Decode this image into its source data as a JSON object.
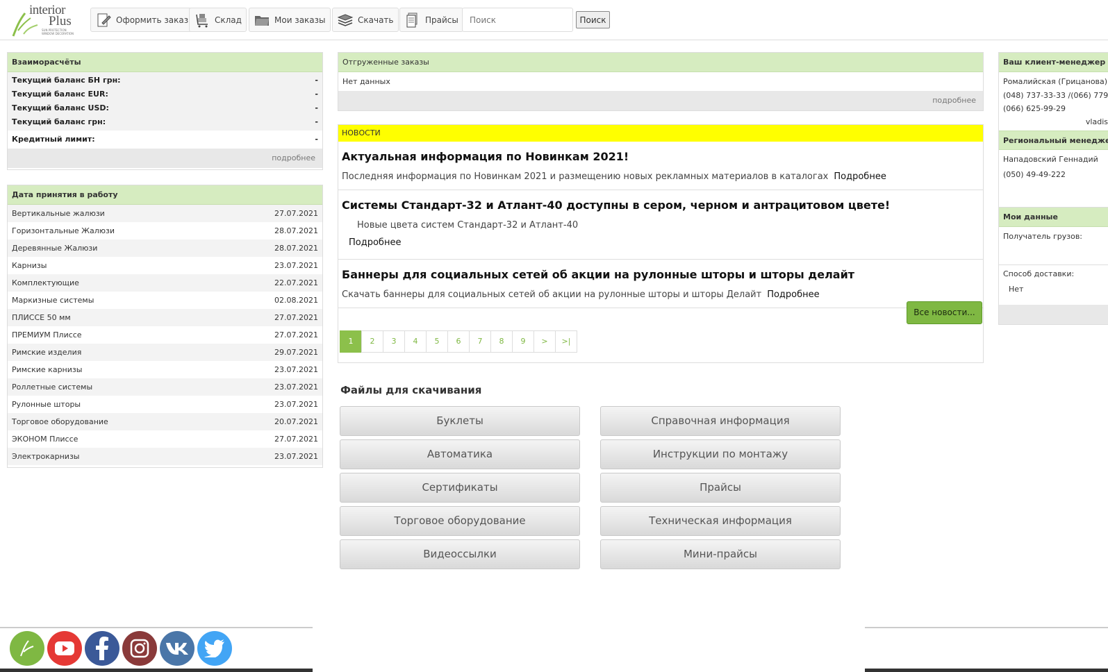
{
  "header": {
    "logo_word1": "interior",
    "logo_word2": "Plus",
    "logo_tagline": "SUN PROTECTION WINDOW DECORATION",
    "nav": [
      {
        "label": "Оформить заказ",
        "icon": "edit-order-icon"
      },
      {
        "label": "Склад",
        "icon": "warehouse-cart-icon"
      },
      {
        "label": "Мои заказы",
        "icon": "folder-icon"
      },
      {
        "label": "Скачать",
        "icon": "stack-download-icon"
      },
      {
        "label": "Прайсы",
        "icon": "price-document-icon"
      }
    ],
    "search_placeholder": "Поиск",
    "search_button": "Поиск"
  },
  "balance": {
    "title": "Взаиморасчёты",
    "rows": [
      {
        "label": "Текущий баланс БН грн:",
        "value": "-"
      },
      {
        "label": "Текущий баланс EUR:",
        "value": "-"
      },
      {
        "label": "Текущий баланс USD:",
        "value": "-"
      },
      {
        "label": "Текущий баланс грн:",
        "value": "-"
      }
    ],
    "credit_label": "Кредитный лимит:",
    "credit_value": "-",
    "more": "подробнее"
  },
  "accept_dates": {
    "title": "Дата принятия в работу",
    "rows": [
      {
        "name": "Вертикальные жалюзи",
        "date": "27.07.2021"
      },
      {
        "name": "Горизонтальные Жалюзи",
        "date": "28.07.2021"
      },
      {
        "name": "Деревянные Жалюзи",
        "date": "28.07.2021"
      },
      {
        "name": "Карнизы",
        "date": "23.07.2021"
      },
      {
        "name": "Комплектующие",
        "date": "22.07.2021"
      },
      {
        "name": "Маркизные системы",
        "date": "02.08.2021"
      },
      {
        "name": "ПЛИССЕ 50 мм",
        "date": "27.07.2021"
      },
      {
        "name": "ПРЕМИУМ Плиссе",
        "date": "27.07.2021"
      },
      {
        "name": "Римские изделия",
        "date": "29.07.2021"
      },
      {
        "name": "Римские карнизы",
        "date": "23.07.2021"
      },
      {
        "name": "Роллетные системы",
        "date": "23.07.2021"
      },
      {
        "name": "Рулонные шторы",
        "date": "23.07.2021"
      },
      {
        "name": "Торговое оборудование",
        "date": "20.07.2021"
      },
      {
        "name": "ЭКОНОМ Плиссе",
        "date": "27.07.2021"
      },
      {
        "name": "Электрокарнизы",
        "date": "23.07.2021"
      }
    ]
  },
  "shipped": {
    "title": "Отгруженные заказы",
    "empty": "Нет данных",
    "more": "подробнее"
  },
  "news": {
    "title": "НОВОСТИ",
    "items": [
      {
        "title": "Актуальная информация по Новинкам 2021!",
        "text": "Последняя информация по Новинкам 2021 и размещению новых рекламных материалов в каталогах",
        "link": "Подробнее"
      },
      {
        "title": "Системы Стандарт-32 и Атлант-40 доступны в сером, черном и антрацитовом цвете!",
        "text": "Новые цвета систем Стандарт-32 и Атлант-40",
        "link": "Подробнее"
      },
      {
        "title": "Баннеры для социальных сетей об акции на рулонные шторы и шторы делайт",
        "text": "Скачать баннеры для социальных сетей об акции на рулонные шторы и шторы Делайт",
        "link": "Подробнее"
      }
    ],
    "all_news": "Все новости...",
    "pages": [
      "1",
      "2",
      "3",
      "4",
      "5",
      "6",
      "7",
      "8",
      "9",
      ">",
      ">|"
    ],
    "active_page": "1"
  },
  "files": {
    "title": "Файлы для скачивания",
    "buttons": [
      "Буклеты",
      "Справочная информация",
      "Автоматика",
      "Инструкции по монтажу",
      "Сертификаты",
      "Прайсы",
      "Торговое оборудование",
      "Техническая информация",
      "Видеоссылки",
      "Мини-прайсы"
    ]
  },
  "client_manager": {
    "title": "Ваш клиент-менеджер",
    "name": "Ромалийская (Грицанова) Е",
    "phone1": "(048) 737-33-33 /(066) 779",
    "phone2": "(066) 625-99-29",
    "skype": "vladis"
  },
  "regional_manager": {
    "title": "Региональный менеджер",
    "name": "Нападовский Геннадий",
    "phone": "(050) 49-49-222"
  },
  "my_data": {
    "title": "Мои данные",
    "recipient_label": "Получатель грузов:",
    "delivery_label": "Способ доставки:",
    "delivery_value": "Нет"
  },
  "social": [
    {
      "name": "interior-plus-logo-icon",
      "color": "#7fb843"
    },
    {
      "name": "youtube-icon",
      "color": "#e53935"
    },
    {
      "name": "facebook-icon",
      "color": "#3b5998"
    },
    {
      "name": "instagram-icon",
      "color": "#8a3a3a"
    },
    {
      "name": "vk-icon",
      "color": "#4a76a8"
    },
    {
      "name": "twitter-icon",
      "color": "#42a5f5"
    }
  ]
}
